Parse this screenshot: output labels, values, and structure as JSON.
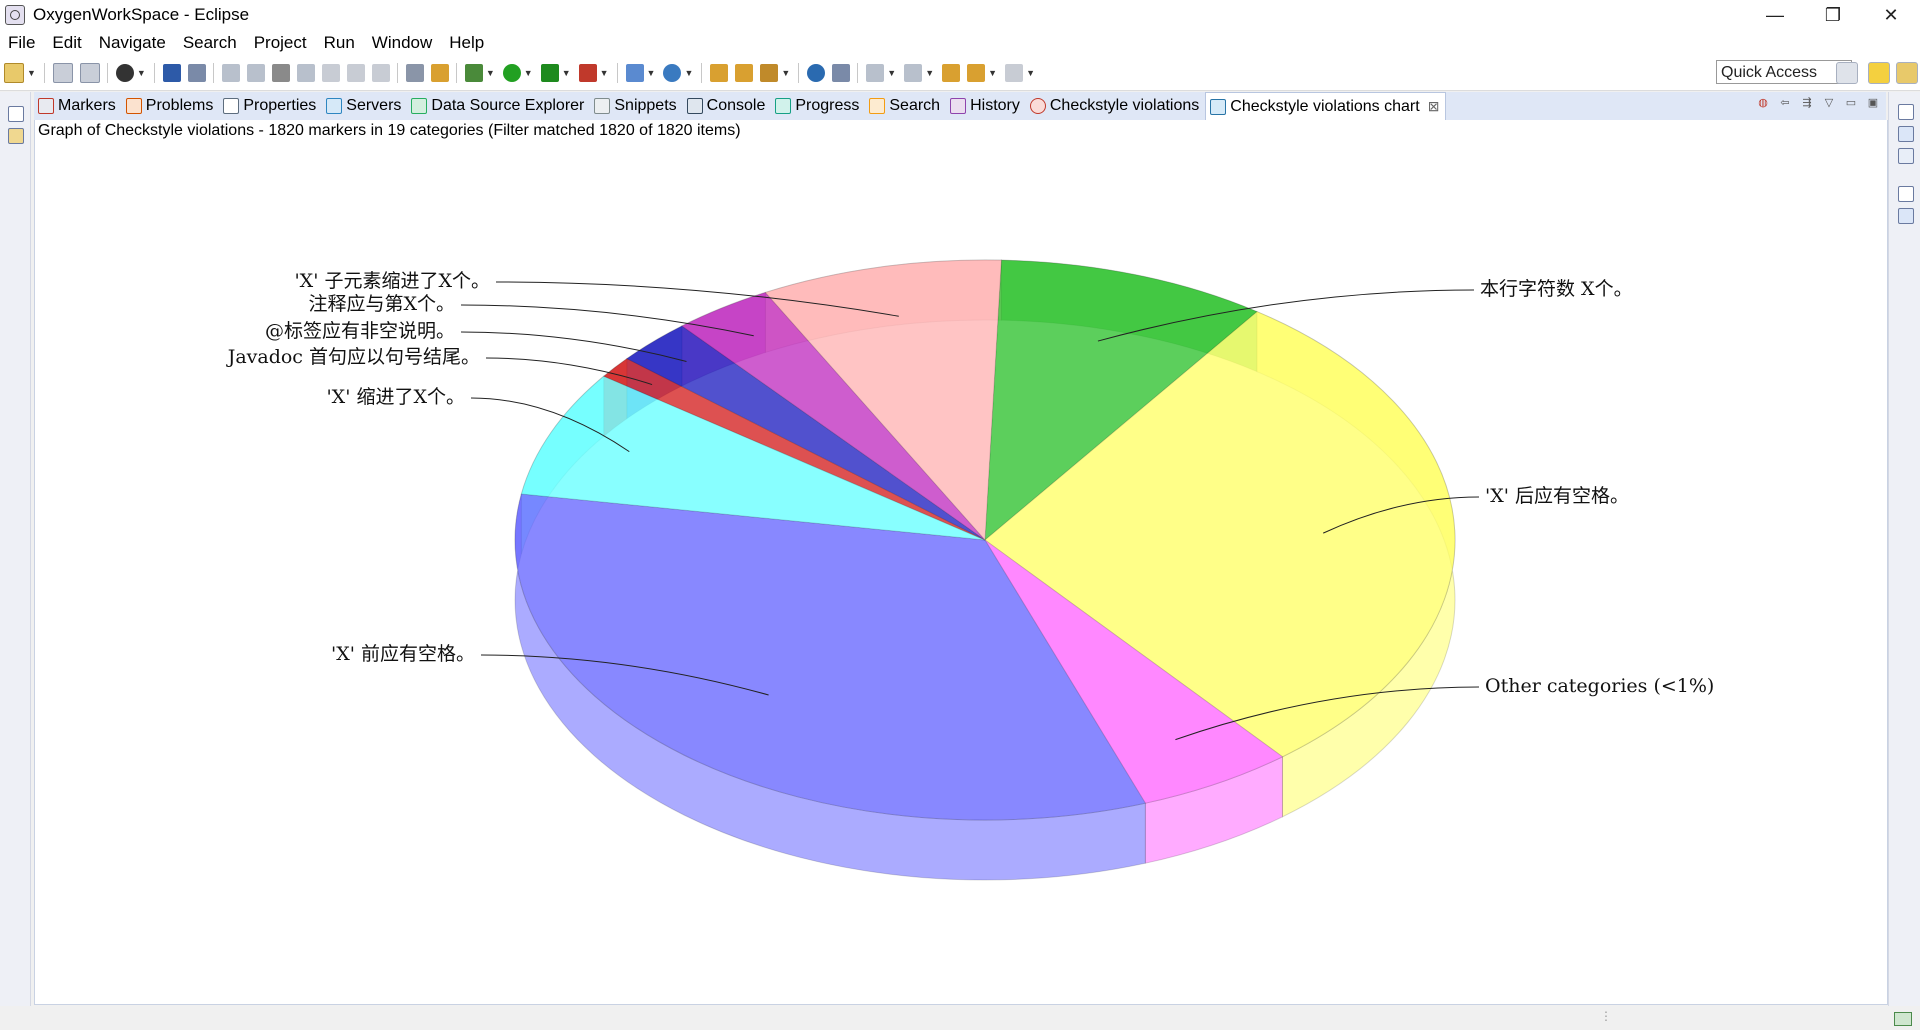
{
  "window": {
    "title": "OxygenWorkSpace - Eclipse",
    "minimize": "—",
    "restore": "❐",
    "close": "✕"
  },
  "menu": [
    "File",
    "Edit",
    "Navigate",
    "Search",
    "Project",
    "Run",
    "Window",
    "Help"
  ],
  "toolbar": {
    "quick_access": "Quick Access"
  },
  "tabs": [
    {
      "label": "Markers",
      "icon": "markers-icon",
      "color": "#c0392b"
    },
    {
      "label": "Problems",
      "icon": "problems-icon",
      "color": "#d35400"
    },
    {
      "label": "Properties",
      "icon": "properties-icon",
      "color": "#5d6d7e"
    },
    {
      "label": "Servers",
      "icon": "servers-icon",
      "color": "#2e86c1"
    },
    {
      "label": "Data Source Explorer",
      "icon": "data-source-icon",
      "color": "#27ae60"
    },
    {
      "label": "Snippets",
      "icon": "snippets-icon",
      "color": "#7f8c8d"
    },
    {
      "label": "Console",
      "icon": "console-icon",
      "color": "#34495e"
    },
    {
      "label": "Progress",
      "icon": "progress-icon",
      "color": "#16a085"
    },
    {
      "label": "Search",
      "icon": "search-icon",
      "color": "#f39c12"
    },
    {
      "label": "History",
      "icon": "history-icon",
      "color": "#8e44ad"
    },
    {
      "label": "Checkstyle violations",
      "icon": "checkstyle-icon",
      "color": "#c0392b"
    },
    {
      "label": "Checkstyle violations chart",
      "icon": "checkstyle-chart-icon",
      "color": "#2874a6",
      "active": true,
      "close": "⊠"
    }
  ],
  "view": {
    "summary": "Graph of Checkstyle violations - 1820 markers in 19 categories (Filter matched 1820 of 1820 items)"
  },
  "chart_data": {
    "type": "pie",
    "style": "3d-exploded-transparent",
    "total_markers": 1820,
    "categories_count": 19,
    "slices": [
      {
        "label": "本行字符数 X个。",
        "percent": 9.5,
        "color": "#2ec22e"
      },
      {
        "label": "'X' 后应有空格。",
        "percent": 30.0,
        "color": "#ffff66"
      },
      {
        "label": "Other categories (<1%)",
        "percent": 5.5,
        "color": "#ff66ff"
      },
      {
        "label": "'X' 前应有空格。",
        "percent": 34.0,
        "color": "#6666ff"
      },
      {
        "label": "'X' 缩进了X个。",
        "percent": 7.5,
        "color": "#66ffff"
      },
      {
        "label": "Javadoc 首句应以句号结尾。",
        "percent": 1.3,
        "color": "#d42020"
      },
      {
        "label": "@标签应有非空说明。",
        "percent": 2.7,
        "color": "#2020c0"
      },
      {
        "label": "注释应与第X个。",
        "percent": 3.5,
        "color": "#c030c0"
      },
      {
        "label": "'X' 子元素缩进了X个。",
        "percent": 8.5,
        "color": "#ffb3b3"
      }
    ]
  }
}
